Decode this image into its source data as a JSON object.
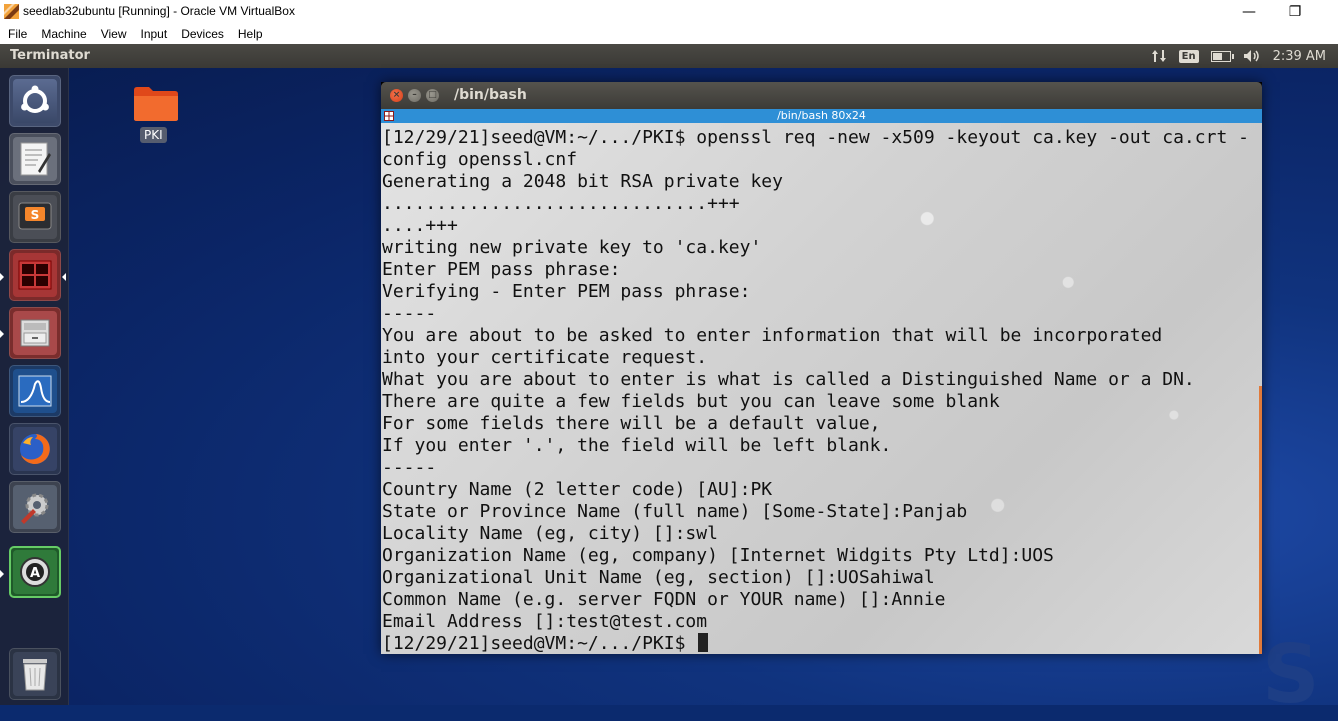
{
  "host_window": {
    "title": "seedlab32ubuntu [Running] - Oracle VM VirtualBox",
    "minimize": "—",
    "restore": "❐",
    "menu": [
      "File",
      "Machine",
      "View",
      "Input",
      "Devices",
      "Help"
    ]
  },
  "top_panel": {
    "app_name": "Terminator",
    "keyboard_layout": "En",
    "clock": "2:39 AM"
  },
  "desktop": {
    "folder_label": "PKI"
  },
  "launcher": {
    "items": [
      "ubuntu-dash",
      "text-editor",
      "sublime-text",
      "terminator",
      "file-manager",
      "wireshark",
      "firefox",
      "system-settings",
      "software-updater",
      "trash"
    ]
  },
  "terminal": {
    "window_title": "/bin/bash",
    "tab_title": "/bin/bash 80x24",
    "lines": [
      "[12/29/21]seed@VM:~/.../PKI$ openssl req -new -x509 -keyout ca.key -out ca.crt -",
      "config openssl.cnf",
      "Generating a 2048 bit RSA private key",
      "..............................+++",
      "....+++",
      "writing new private key to 'ca.key'",
      "Enter PEM pass phrase:",
      "Verifying - Enter PEM pass phrase:",
      "-----",
      "You are about to be asked to enter information that will be incorporated",
      "into your certificate request.",
      "What you are about to enter is what is called a Distinguished Name or a DN.",
      "There are quite a few fields but you can leave some blank",
      "For some fields there will be a default value,",
      "If you enter '.', the field will be left blank.",
      "-----",
      "Country Name (2 letter code) [AU]:PK",
      "State or Province Name (full name) [Some-State]:Panjab",
      "Locality Name (eg, city) []:swl",
      "Organization Name (eg, company) [Internet Widgits Pty Ltd]:UOS",
      "Organizational Unit Name (eg, section) []:UOSahiwal",
      "Common Name (e.g. server FQDN or YOUR name) []:Annie",
      "Email Address []:test@test.com"
    ],
    "prompt": "[12/29/21]seed@VM:~/.../PKI$ "
  },
  "colors": {
    "tab_bar": "#2e8fd6",
    "close_button": "#e95420",
    "panel": "#3c3b37"
  }
}
